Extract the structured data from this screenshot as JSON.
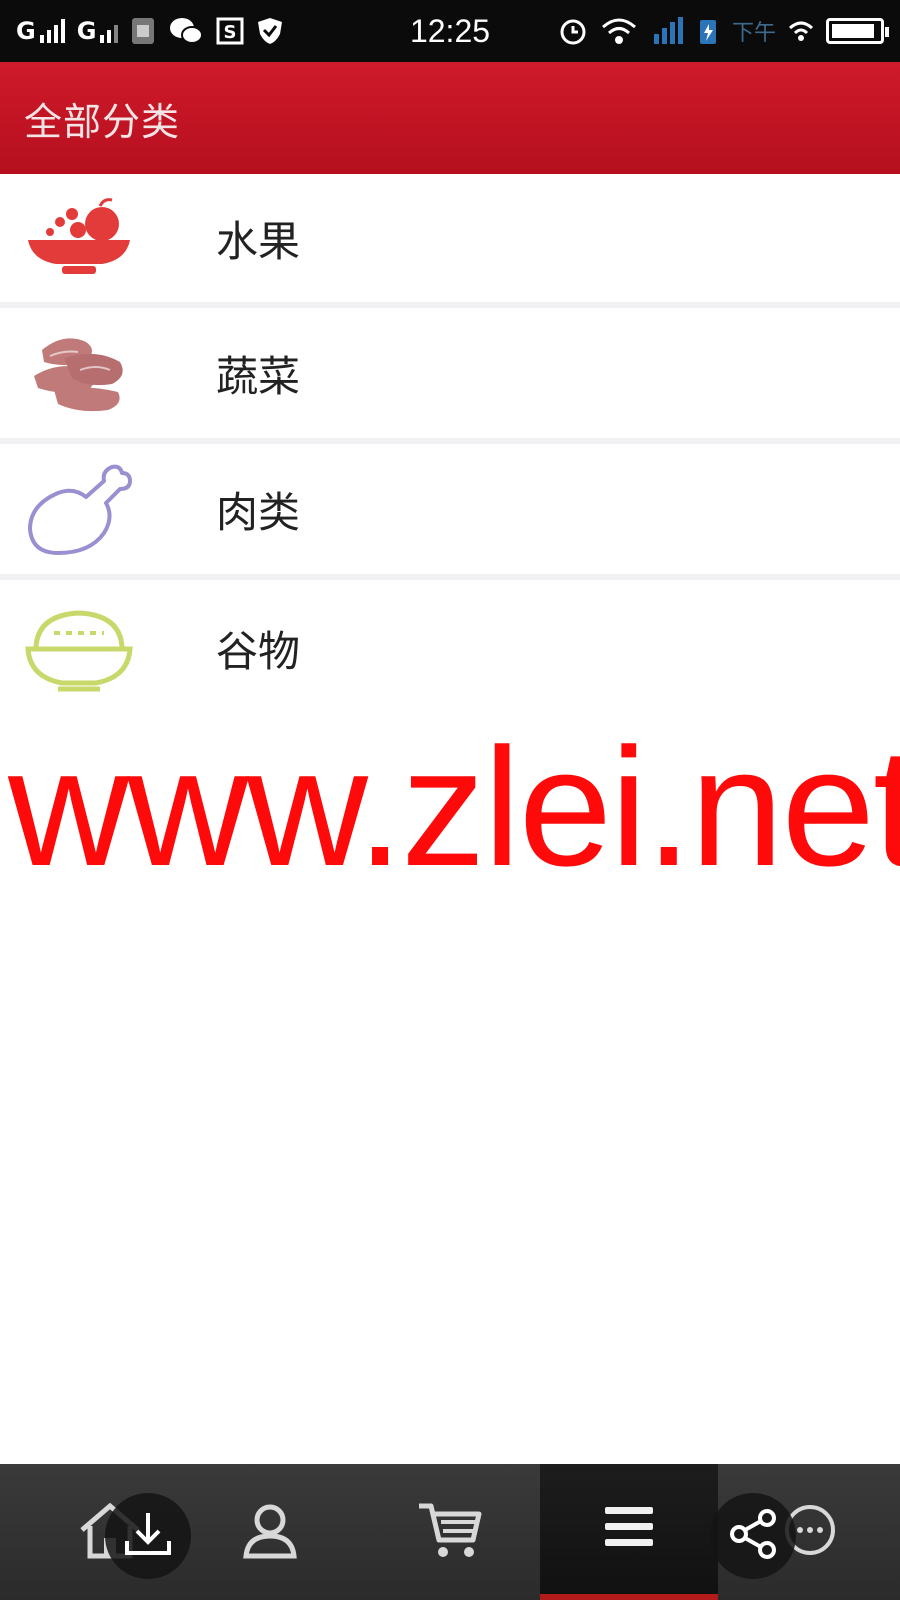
{
  "status_bar": {
    "carrier1": "G",
    "carrier2": "G",
    "time": "12:25",
    "ampm": "下午"
  },
  "header": {
    "title": "全部分类"
  },
  "categories": [
    {
      "label": "水果",
      "icon": "fruit-bowl-icon",
      "color": "#e33a3a"
    },
    {
      "label": "蔬菜",
      "icon": "vegetable-icon",
      "color": "#c07a7a"
    },
    {
      "label": "肉类",
      "icon": "drumstick-icon",
      "color": "#9a8fd0"
    },
    {
      "label": "谷物",
      "icon": "rice-bowl-icon",
      "color": "#c8d86a"
    }
  ],
  "watermark": {
    "text": "www.zlei.net"
  },
  "bottom_nav": {
    "items": [
      {
        "name": "home",
        "icon": "home-icon"
      },
      {
        "name": "user",
        "icon": "user-icon"
      },
      {
        "name": "cart",
        "icon": "cart-icon"
      },
      {
        "name": "menu",
        "icon": "menu-icon",
        "active": true
      },
      {
        "name": "more",
        "icon": "more-icon"
      }
    ],
    "active_color": "#b31b1b"
  },
  "floating": {
    "download": "download-icon",
    "share": "share-icon"
  },
  "colors": {
    "header": "#c3172a",
    "status_bar": "#0b0b0b",
    "watermark": "#ff0a0a"
  }
}
